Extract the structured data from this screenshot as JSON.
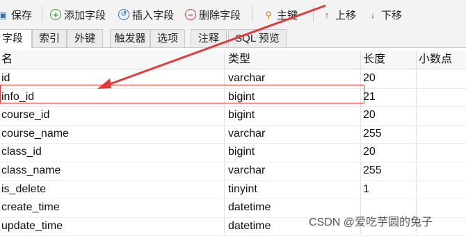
{
  "toolbar": {
    "save": "保存",
    "add_field": "添加字段",
    "insert_field": "插入字段",
    "delete_field": "删除字段",
    "primary_key": "主键",
    "move_up": "上移",
    "move_down": "下移"
  },
  "tabs": [
    "字段",
    "索引",
    "外键",
    "触发器",
    "选项",
    "注释",
    "SQL 预览"
  ],
  "columns": {
    "name": "名",
    "type": "类型",
    "length": "长度",
    "decimals": "小数点"
  },
  "rows": [
    {
      "name": "id",
      "type": "varchar",
      "length": "20"
    },
    {
      "name": "info_id",
      "type": "bigint",
      "length": "21"
    },
    {
      "name": "course_id",
      "type": "bigint",
      "length": "20"
    },
    {
      "name": "course_name",
      "type": "varchar",
      "length": "255"
    },
    {
      "name": "class_id",
      "type": "bigint",
      "length": "20"
    },
    {
      "name": "class_name",
      "type": "varchar",
      "length": "255"
    },
    {
      "name": "is_delete",
      "type": "tinyint",
      "length": "1"
    },
    {
      "name": "create_time",
      "type": "datetime",
      "length": ""
    },
    {
      "name": "update_time",
      "type": "datetime",
      "length": ""
    }
  ],
  "watermark": "CSDN @爱吃芋圆的兔子",
  "colors": {
    "annotation_red": "#e23b3b",
    "add_green": "#3a9d3a",
    "insert_blue": "#2f6fd6",
    "delete_red": "#d63a3a"
  }
}
